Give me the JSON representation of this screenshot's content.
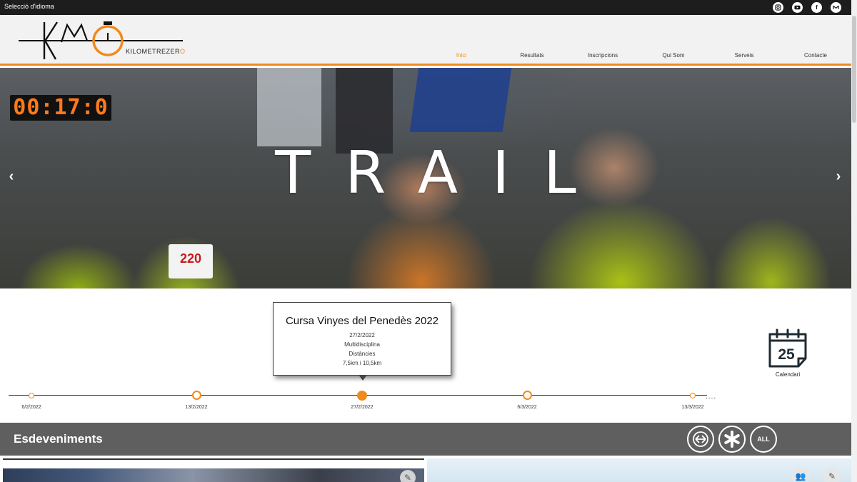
{
  "topbar": {
    "language_label": "Selecció d'idioma",
    "socials": [
      {
        "name": "instagram-icon",
        "glyph": "◎"
      },
      {
        "name": "youtube-icon",
        "glyph": "▶"
      },
      {
        "name": "facebook-icon",
        "glyph": "f"
      },
      {
        "name": "mail-icon",
        "glyph": "M"
      }
    ]
  },
  "brand": {
    "logo_mark": "KMO",
    "logo_text_main": "KILOMETREZER",
    "logo_text_accent": "O"
  },
  "nav": {
    "items": [
      "Inici",
      "Resultats",
      "Inscripcions",
      "Qui Som",
      "Serveis",
      "Contacte"
    ],
    "active": "Inici"
  },
  "hero": {
    "title": "TRAIL",
    "timer": "00:17:0",
    "bib_number": "220",
    "prev_glyph": "‹",
    "next_glyph": "›"
  },
  "timeline": {
    "selected_event": {
      "title": "Cursa Vinyes del Penedès 2022",
      "date": "27/2/2022",
      "type": "Multidisciplina",
      "distances_label": "Distàncies",
      "distances": "7,5km i 10,5km"
    },
    "dates": [
      "6/2/2022",
      "13/2/2022",
      "27/2/2022",
      "6/3/2022",
      "13/3/2022"
    ],
    "active_index": 2,
    "more": "...."
  },
  "calendar": {
    "day": "25",
    "label": "Calendari"
  },
  "events": {
    "title": "Esdeveniments",
    "filters": [
      "arrows-circle-icon",
      "asterisk-icon",
      "ALL"
    ],
    "all_label": "ALL"
  },
  "colors": {
    "accent": "#f08a1c",
    "topbar": "#1d1d1d",
    "band": "#5f5f5f"
  }
}
